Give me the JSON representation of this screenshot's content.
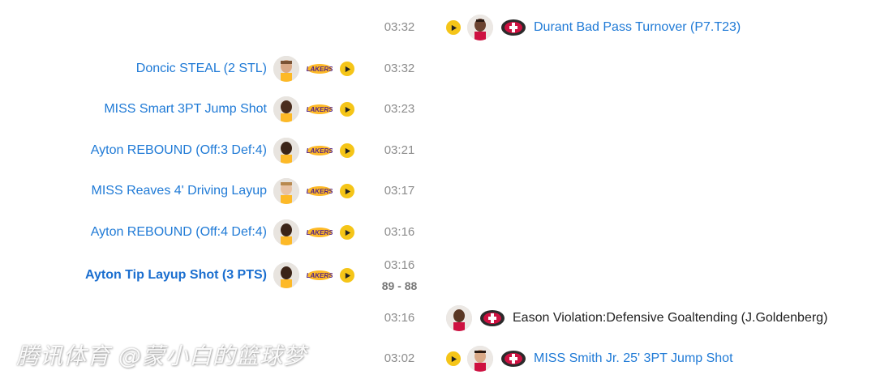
{
  "plays": [
    {
      "time": "03:32",
      "side": "right",
      "text": "Durant Bad Pass Turnover (P7.T23)",
      "team": "rockets",
      "player_avatar": "durant-avatar",
      "has_play": true
    },
    {
      "time": "03:32",
      "side": "left",
      "text": "Doncic STEAL (2 STL)",
      "team": "lakers",
      "player_avatar": "doncic-avatar",
      "has_play": true
    },
    {
      "time": "03:23",
      "side": "left",
      "text": "MISS Smart 3PT Jump Shot",
      "team": "lakers",
      "player_avatar": "smart-avatar",
      "has_play": true
    },
    {
      "time": "03:21",
      "side": "left",
      "text": "Ayton REBOUND (Off:3 Def:4)",
      "team": "lakers",
      "player_avatar": "ayton-avatar",
      "has_play": true
    },
    {
      "time": "03:17",
      "side": "left",
      "text": "MISS Reaves 4' Driving Layup",
      "team": "lakers",
      "player_avatar": "reaves-avatar",
      "has_play": true
    },
    {
      "time": "03:16",
      "side": "left",
      "text": "Ayton REBOUND (Off:4 Def:4)",
      "team": "lakers",
      "player_avatar": "ayton-avatar",
      "has_play": true
    },
    {
      "time": "03:16",
      "side": "left",
      "text": "Ayton Tip Layup Shot (3 PTS)",
      "score": "89 - 88",
      "bold": true,
      "team": "lakers",
      "player_avatar": "ayton-avatar",
      "has_play": true
    },
    {
      "time": "03:16",
      "side": "right",
      "text": "Eason Violation:Defensive Goaltending (J.Goldenberg)",
      "team": "rockets",
      "player_avatar": "eason-avatar",
      "has_play": false
    },
    {
      "time": "03:02",
      "side": "right",
      "text": "MISS Smith Jr. 25' 3PT Jump Shot",
      "team": "rockets",
      "player_avatar": "smith-avatar",
      "has_play": true
    }
  ],
  "watermark": "腾讯体育 @蒙小白的篮球梦",
  "colors": {
    "link_blue": "#1f7ad6",
    "play_yellow": "#f5c518",
    "lakers_purple": "#552583",
    "lakers_gold": "#fdb927",
    "rockets_red": "#ce1141",
    "time_gray": "#8c8c8c"
  }
}
